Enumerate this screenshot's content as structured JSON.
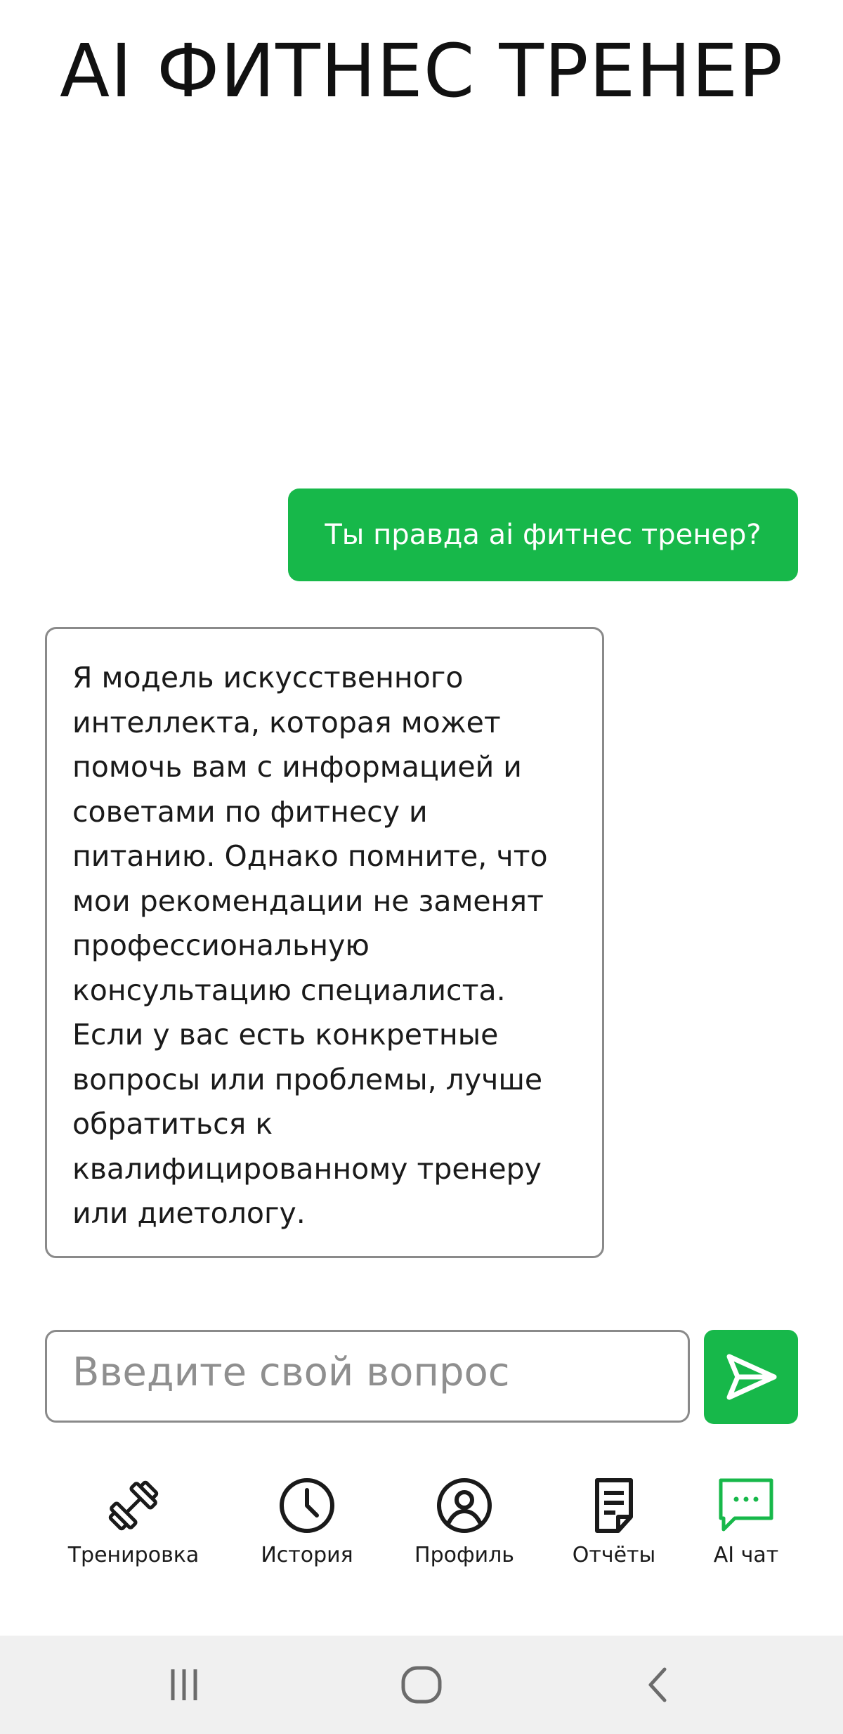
{
  "header": {
    "title": "AI ФИТНЕС ТРЕНЕР"
  },
  "chat": {
    "user_message": "Ты правда ai фитнес тренер?",
    "ai_message": "Я модель искусственного\nинтеллекта, которая может\nпомочь вам с информацией и\nсоветами по фитнесу и\nпитанию. Однако помните, что\nмои рекомендации не заменят\nпрофессиональную\nконсультацию специалиста.\nЕсли у вас есть конкретные\nвопросы или проблемы, лучше\nобратиться к\nквалифицированному тренеру\nили диетологу."
  },
  "input": {
    "placeholder": "Введите свой вопрос",
    "value": ""
  },
  "colors": {
    "accent": "#17b84a",
    "border": "#8a8a8a",
    "system_bar": "#f0f0f0"
  },
  "nav": {
    "items": [
      {
        "label": "Тренировка",
        "icon": "dumbbell-icon"
      },
      {
        "label": "История",
        "icon": "clock-icon"
      },
      {
        "label": "Профиль",
        "icon": "user-circle-icon"
      },
      {
        "label": "Отчёты",
        "icon": "document-icon"
      },
      {
        "label": "AI чат",
        "icon": "chat-icon",
        "active": true
      }
    ]
  },
  "system_nav": {
    "icons": [
      "recent-apps-icon",
      "home-icon",
      "back-icon"
    ]
  }
}
